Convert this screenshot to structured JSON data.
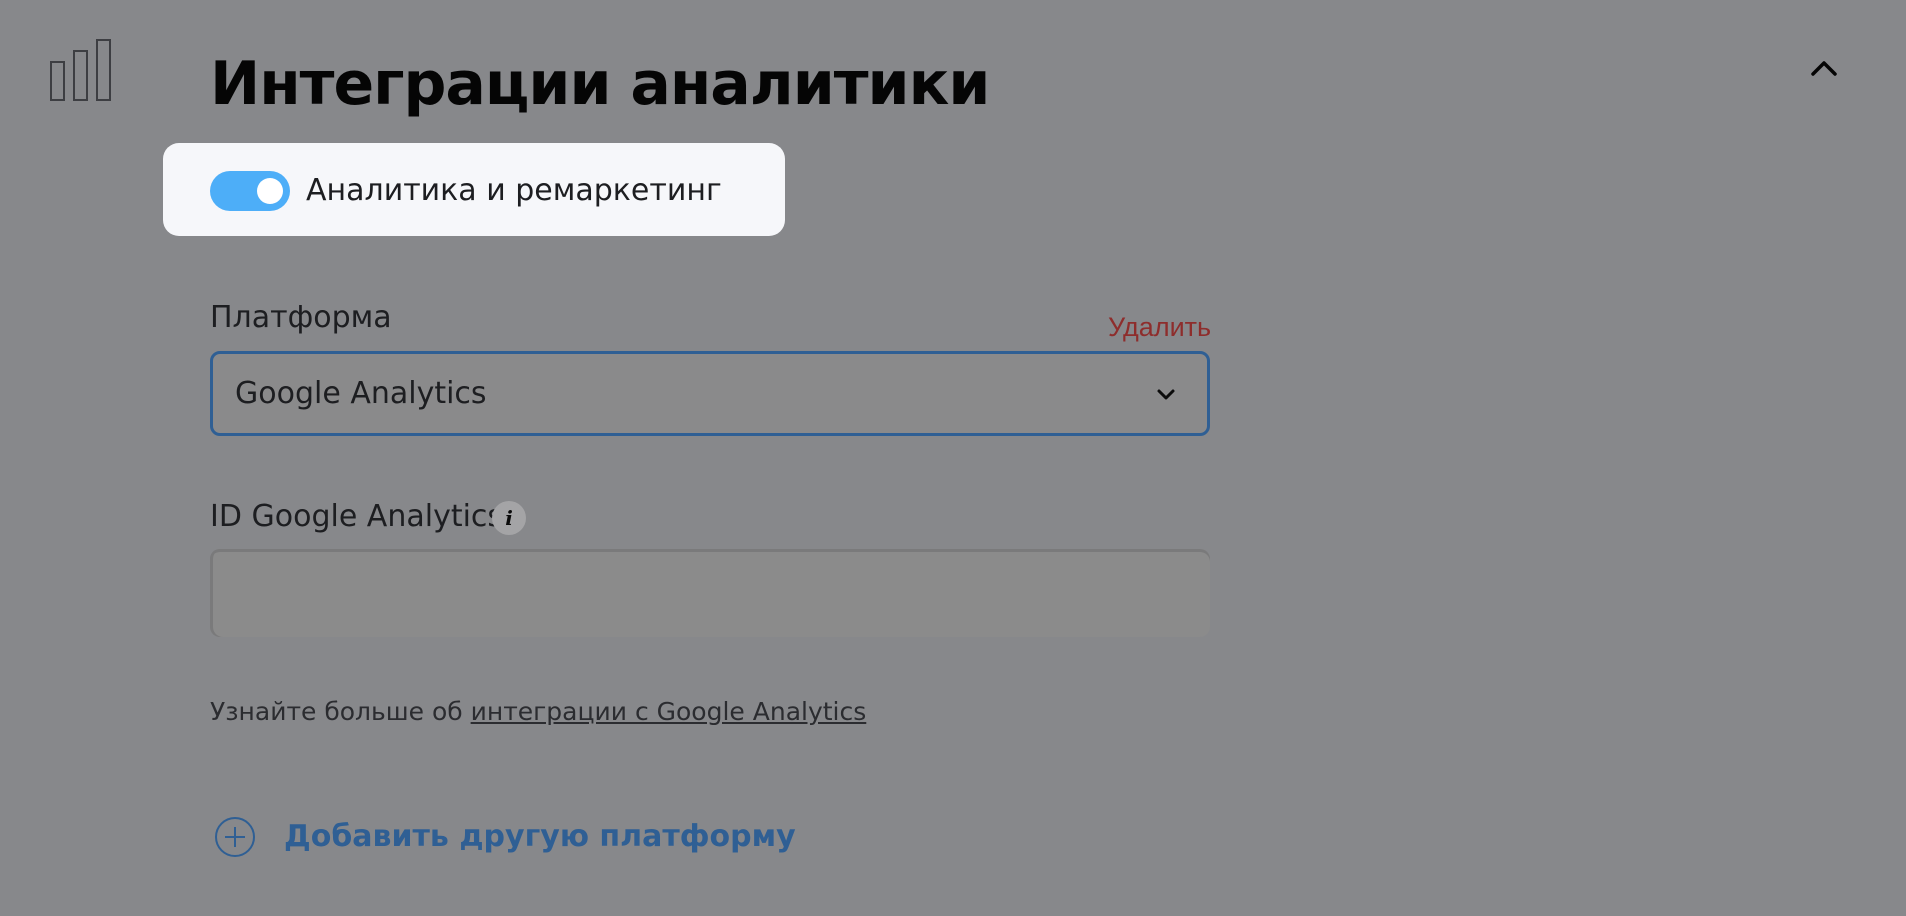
{
  "section": {
    "icon": "bar-chart-icon",
    "title": "Интеграции аналитики",
    "collapse_icon": "chevron-up-icon"
  },
  "toggle": {
    "label": "Аналитика и ремаркетинг",
    "enabled": true,
    "color": "#4daef8"
  },
  "platform": {
    "label": "Платформа",
    "delete_label": "Удалить",
    "delete_color": "#8e2d2c",
    "selected": "Google Analytics",
    "dropdown_icon": "chevron-down-icon",
    "border_color": "#2f5f94"
  },
  "id_field": {
    "label": "ID Google Analytics",
    "info_icon_glyph": "i",
    "value": ""
  },
  "help": {
    "text": "Узнайте больше об ",
    "link_text": "интеграции с Google Analytics"
  },
  "add_platform": {
    "icon": "plus-circle-icon",
    "label": "Добавить другую платформу",
    "color": "#2f5f94"
  }
}
